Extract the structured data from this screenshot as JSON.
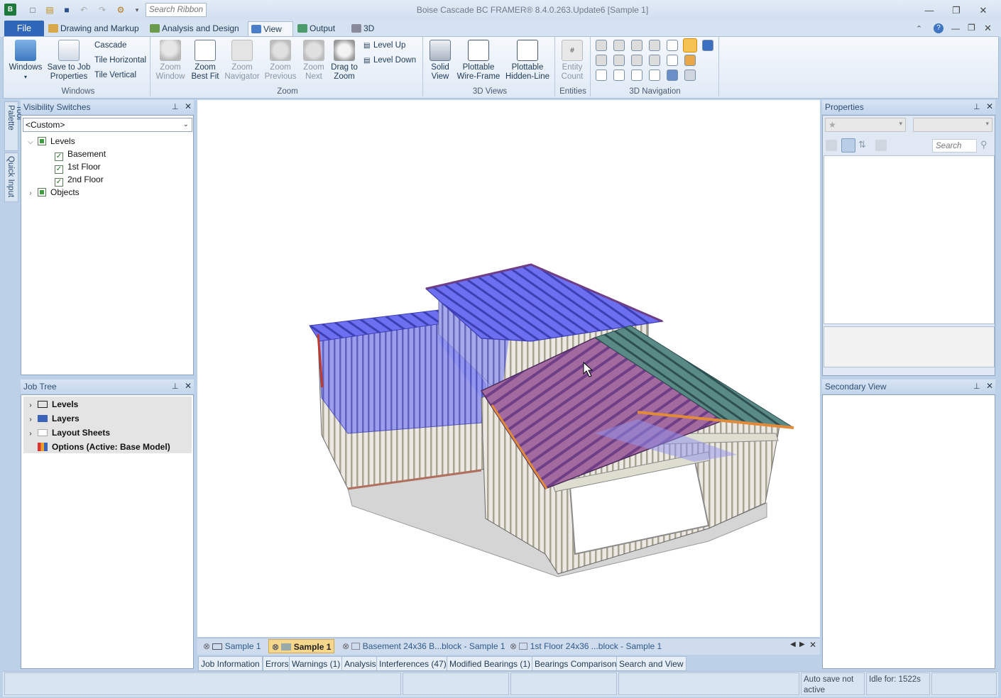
{
  "app": {
    "title": "Boise Cascade BC FRAMER® 8.4.0.263.Update6  [Sample 1]",
    "search_placeholder": "Search Ribbon"
  },
  "ribbon_tabs": [
    "File",
    "Drawing and Markup",
    "Analysis and Design",
    "View",
    "Output",
    "3D"
  ],
  "ribbon": {
    "windows_group": {
      "label": "Windows",
      "windows": "Windows",
      "save_to_job": "Save to Job",
      "properties": "Properties",
      "cascade": "Cascade",
      "tile_horizontal": "Tile Horizontal",
      "tile_vertical": "Tile Vertical"
    },
    "zoom_group": {
      "label": "Zoom",
      "zoom_window_1": "Zoom",
      "zoom_window_2": "Window",
      "zoom_best_1": "Zoom",
      "zoom_best_2": "Best Fit",
      "zoom_nav_1": "Zoom",
      "zoom_nav_2": "Navigator",
      "zoom_prev_1": "Zoom",
      "zoom_prev_2": "Previous",
      "zoom_next_1": "Zoom",
      "zoom_next_2": "Next",
      "drag_1": "Drag to",
      "drag_2": "Zoom",
      "level_up": "Level Up",
      "level_down": "Level Down"
    },
    "views_group": {
      "label": "3D Views",
      "solid_1": "Solid",
      "solid_2": "View",
      "wire_1": "Plottable",
      "wire_2": "Wire-Frame",
      "hidden_1": "Plottable",
      "hidden_2": "Hidden-Line"
    },
    "entities_group": {
      "label": "Entities",
      "count_1": "Entity",
      "count_2": "Count"
    },
    "nav_group": {
      "label": "3D Navigation"
    }
  },
  "side_tabs": [
    "Tool Palette",
    "Quick Input"
  ],
  "visibility": {
    "title": "Visibility Switches",
    "preset": "<Custom>",
    "levels": "Levels",
    "basement": "Basement",
    "first_floor": "1st Floor",
    "second_floor": "2nd Floor",
    "objects": "Objects"
  },
  "job_tree": {
    "title": "Job Tree",
    "items": [
      "Levels",
      "Layers",
      "Layout Sheets",
      "Options (Active: Base Model)"
    ]
  },
  "properties": {
    "title": "Properties",
    "search_placeholder": "Search"
  },
  "secondary_view": {
    "title": "Secondary View"
  },
  "doc_tabs": [
    "Sample 1",
    "Sample 1",
    "Basement 24x36 B...block - Sample 1",
    "1st Floor 24x36 ...block - Sample 1"
  ],
  "bottom_tabs": [
    "Job Information",
    "Errors",
    "Warnings (1)",
    "Analysis",
    "Interferences (47)",
    "Modified Bearings (1)",
    "Bearings Comparison",
    "Search and View"
  ],
  "status": {
    "autosave": "Auto save not active",
    "idle": "Idle for: 1522s"
  },
  "colors": {
    "file_tab": "#2f66b9",
    "roof_blue": "#5a5ee8",
    "roof_purple": "#6e3f86",
    "wall_gray": "#c8c3b8"
  }
}
